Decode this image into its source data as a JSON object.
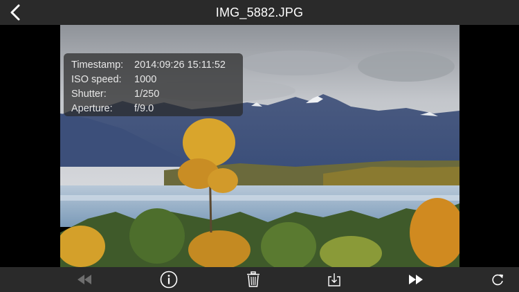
{
  "header": {
    "title": "IMG_5882.JPG",
    "back_icon": "chevron-left-icon"
  },
  "exif": {
    "rows": [
      {
        "label": "Timestamp:",
        "value": "2014:09:26 15:11:52"
      },
      {
        "label": "ISO speed:",
        "value": "1000"
      },
      {
        "label": "Shutter:",
        "value": "1/250"
      },
      {
        "label": "Aperture:",
        "value": "f/9.0"
      }
    ]
  },
  "toolbar": {
    "items": [
      {
        "icon": "rewind-icon",
        "enabled": false
      },
      {
        "icon": "info-icon",
        "enabled": true
      },
      {
        "icon": "trash-icon",
        "enabled": true
      },
      {
        "icon": "download-icon",
        "enabled": true
      },
      {
        "icon": "fast-forward-icon",
        "enabled": true
      },
      {
        "icon": "rotate-icon",
        "enabled": true
      }
    ]
  },
  "colors": {
    "bar_background": "#2a2a2a",
    "icon": "#ffffff",
    "icon_disabled": "#6e6e6e"
  }
}
